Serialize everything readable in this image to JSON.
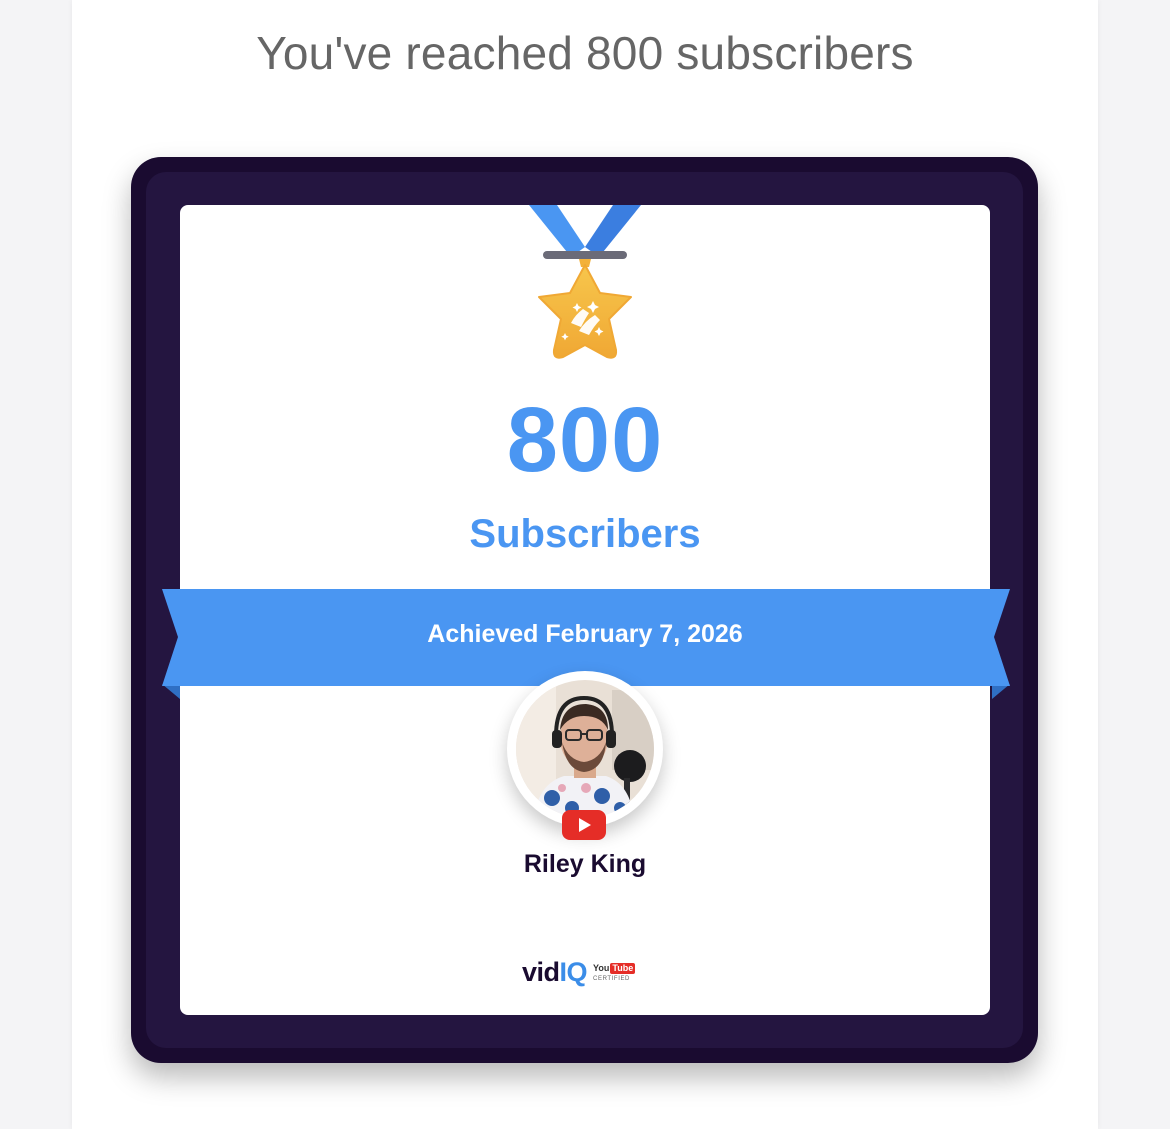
{
  "headline": "You've reached 800 subscribers",
  "milestone": {
    "count": "800",
    "label": "Subscribers",
    "achieved_text": "Achieved February 7, 2026"
  },
  "channel": {
    "name": "Riley King",
    "platform_icon": "youtube-play-icon"
  },
  "brand": {
    "vid": "vid",
    "iq": "IQ",
    "yt_you": "You",
    "yt_tube": "Tube",
    "yt_certified": "CERTIFIED"
  },
  "colors": {
    "accent_blue": "#4a96f2",
    "card_dark": "#1a0b30",
    "medal_gold": "#f4b33c",
    "youtube_red": "#e52d27"
  }
}
